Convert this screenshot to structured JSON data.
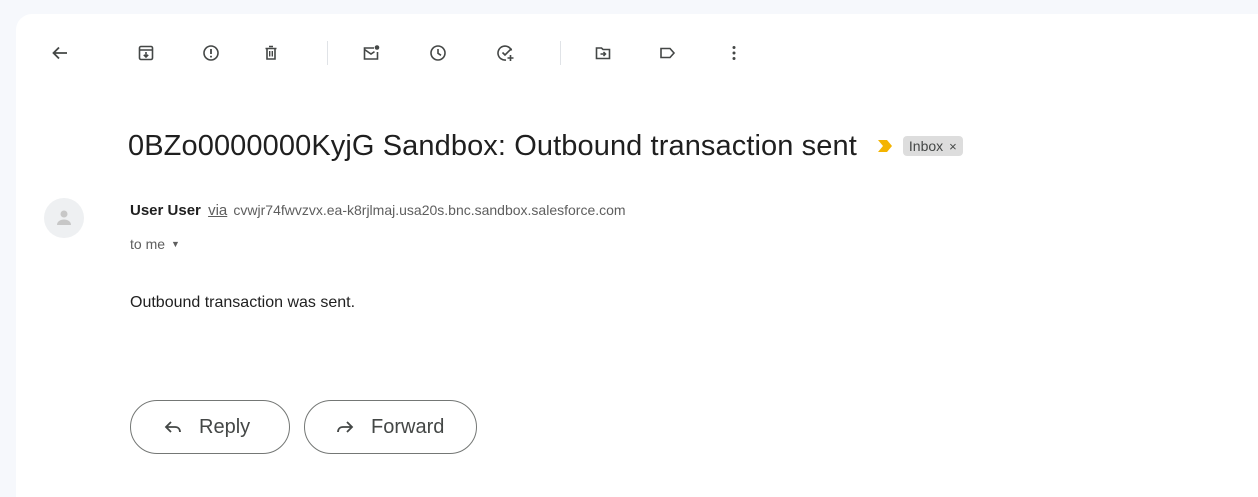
{
  "toolbar": {
    "icons": [
      "back-arrow",
      "archive",
      "report-spam",
      "delete",
      "mark-unread",
      "snooze",
      "add-to-tasks",
      "move-to",
      "label",
      "more"
    ]
  },
  "email": {
    "subject": "0BZo0000000KyjG Sandbox: Outbound transaction sent",
    "label_chip": "Inbox",
    "label_close": "×",
    "sender_name": "User User",
    "via_text": "via",
    "sender_email": "cvwjr74fwvzvx.ea-k8rjlmaj.usa20s.bnc.sandbox.salesforce.com",
    "recipient": "to me",
    "body": "Outbound transaction was sent."
  },
  "actions": {
    "reply_label": "Reply",
    "forward_label": "Forward"
  },
  "colors": {
    "importance_marker": "#f4b400",
    "background": "#f6f8fc",
    "chip": "#dddddd"
  }
}
